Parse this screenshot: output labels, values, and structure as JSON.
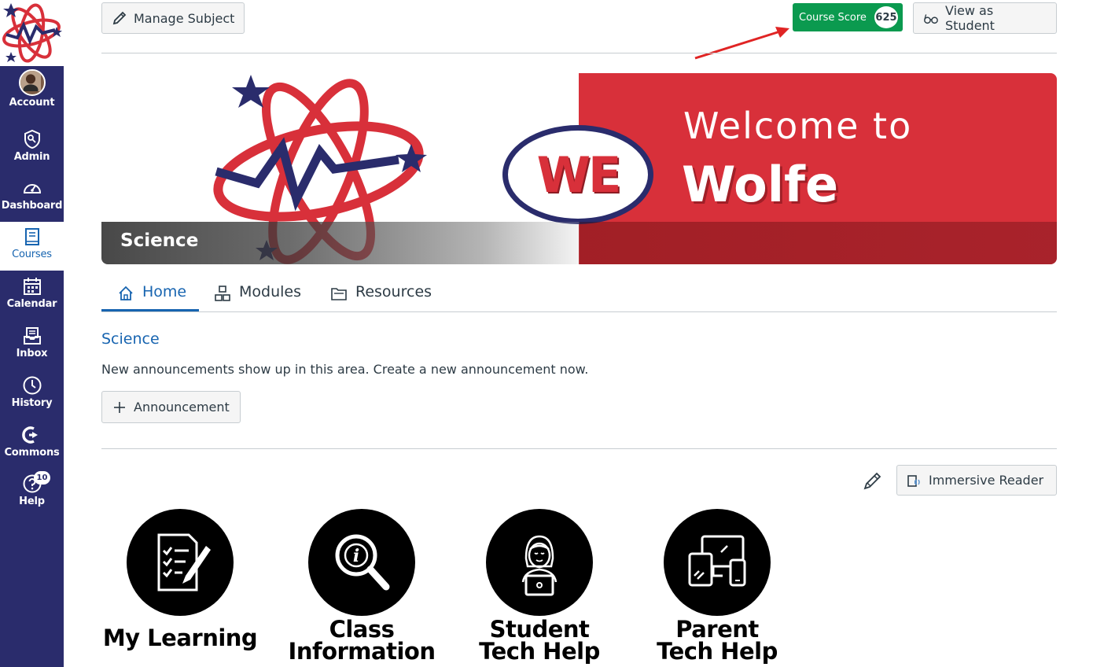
{
  "nav": {
    "items": [
      {
        "label": "Account",
        "icon": "avatar"
      },
      {
        "label": "Admin",
        "icon": "shield-icon"
      },
      {
        "label": "Dashboard",
        "icon": "speedometer-icon"
      },
      {
        "label": "Courses",
        "icon": "book-icon"
      },
      {
        "label": "Calendar",
        "icon": "calendar-icon"
      },
      {
        "label": "Inbox",
        "icon": "inbox-icon"
      },
      {
        "label": "History",
        "icon": "clock-icon"
      },
      {
        "label": "Commons",
        "icon": "commons-icon"
      },
      {
        "label": "Help",
        "icon": "help-icon",
        "badge": "10"
      }
    ],
    "colors": {
      "background": "#2a2c6c",
      "active": "#ffffff"
    }
  },
  "toolbar": {
    "manage_label": "Manage Subject",
    "score_label": "Course Score",
    "score_value": "625",
    "view_student_label": "View as Student"
  },
  "banner": {
    "course_name": "Science",
    "welcome_line1": "Welcome to",
    "welcome_line2": "Wolfe",
    "logo_text": "WE"
  },
  "tabs": [
    {
      "label": "Home",
      "icon": "home-icon",
      "active": true
    },
    {
      "label": "Modules",
      "icon": "modules-icon",
      "active": false
    },
    {
      "label": "Resources",
      "icon": "folder-icon",
      "active": false
    }
  ],
  "main": {
    "section_title": "Science",
    "announcement_text": "New announcements show up in this area. Create a new announcement now.",
    "announcement_button": "Announcement",
    "immersive_reader": "Immersive Reader"
  },
  "tiles": [
    {
      "line1": "My Learning",
      "line2": "",
      "icon": "checklist-pen-icon"
    },
    {
      "line1": "Class",
      "line2": "Information",
      "icon": "info-magnifier-icon"
    },
    {
      "line1": "Student",
      "line2": "Tech Help",
      "icon": "student-laptop-icon"
    },
    {
      "line1": "Parent",
      "line2": "Tech Help",
      "icon": "devices-icon"
    }
  ],
  "colors": {
    "accent": "#1764b0",
    "score_green": "#0b9a4f",
    "banner_red": "#d8303a",
    "navy": "#2a2c6c"
  }
}
